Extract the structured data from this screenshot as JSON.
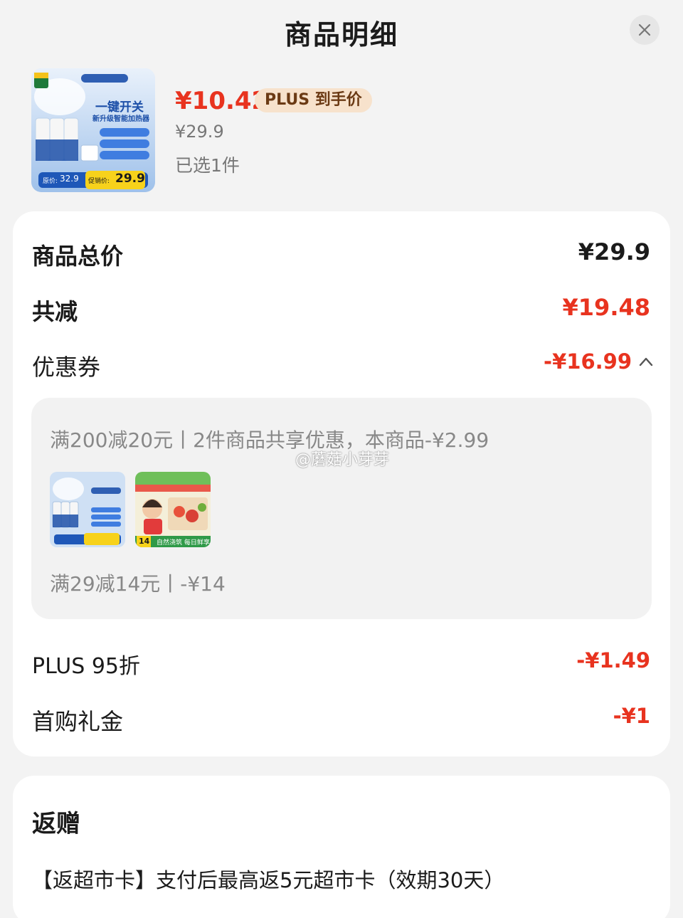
{
  "header": {
    "title": "商品明细",
    "close_icon": "close-icon"
  },
  "product": {
    "price": "¥10.42",
    "plus_badge": "PLUS 到手价",
    "original_price": "¥29.9",
    "selected": "已选1件",
    "image": {
      "headline": "一键开关",
      "subline": "新升级智能加热器",
      "orig_price_label": "原价:",
      "orig_price": "32.9",
      "promo_label": "促销价:",
      "promo_price": "29.9"
    }
  },
  "summary": {
    "total_label": "商品总价",
    "total_value": "¥29.9",
    "reduce_label": "共减",
    "reduce_value": "¥19.48",
    "coupon_label": "优惠券",
    "coupon_value": "-¥16.99",
    "plus_label": "PLUS 95折",
    "plus_value": "-¥1.49",
    "firstbuy_label": "首购礼金",
    "firstbuy_value": "-¥1"
  },
  "coupon_detail": {
    "line1": "满200减20元丨2件商品共享优惠，本商品-¥2.99",
    "line2": "满29减14元丨-¥14",
    "thumb2_tag": "14",
    "thumb2_caption": "自然浇筑 每日鲜享"
  },
  "watermark": "@蘑菇小芽芽",
  "gift": {
    "title": "返赠",
    "text": "【返超市卡】支付后最高返5元超市卡（效期30天）"
  },
  "colors": {
    "accent_red": "#e8331f",
    "badge_bg": "#f7e2cc",
    "badge_text": "#6b3a14"
  }
}
